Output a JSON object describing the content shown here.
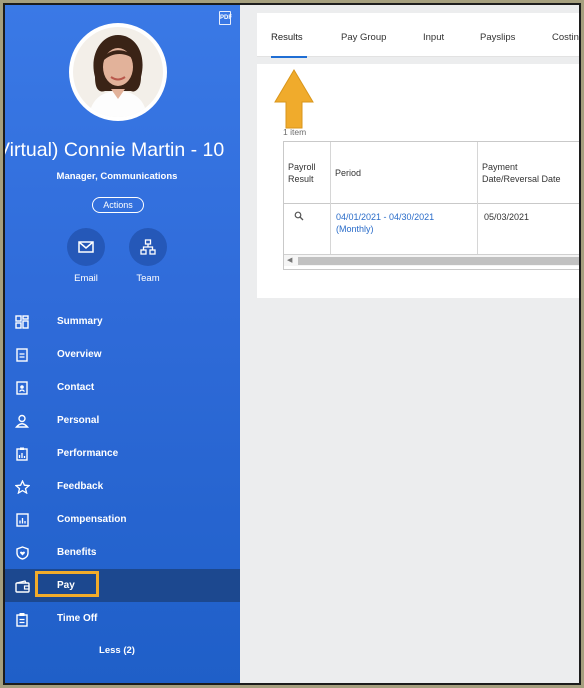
{
  "sidebar": {
    "pdf_label": "PDF",
    "worker_name": "Virtual) Connie Martin - 10",
    "worker_title": "Manager, Communications",
    "actions_label": "Actions",
    "email_label": "Email",
    "team_label": "Team",
    "nav": [
      {
        "label": "Summary",
        "icon": "summary-icon"
      },
      {
        "label": "Overview",
        "icon": "overview-icon"
      },
      {
        "label": "Contact",
        "icon": "contact-icon"
      },
      {
        "label": "Personal",
        "icon": "person-icon"
      },
      {
        "label": "Performance",
        "icon": "performance-icon"
      },
      {
        "label": "Feedback",
        "icon": "star-icon"
      },
      {
        "label": "Compensation",
        "icon": "compensation-icon"
      },
      {
        "label": "Benefits",
        "icon": "benefits-icon"
      },
      {
        "label": "Pay",
        "icon": "wallet-icon"
      },
      {
        "label": "Time Off",
        "icon": "time-off-icon"
      }
    ],
    "less_label": "Less (2)"
  },
  "tabs": [
    "Results",
    "Pay Group",
    "Input",
    "Payslips",
    "Costin"
  ],
  "results": {
    "item_count": "1 item",
    "headers": {
      "payroll_result": [
        "Payroll",
        "Result"
      ],
      "period": "Period",
      "payment_date": [
        "Payment",
        "Date/Reversal Date"
      ]
    },
    "rows": [
      {
        "period": [
          "04/01/2021 - 04/30/2021",
          "(Monthly)"
        ],
        "payment_date": "05/03/2021"
      }
    ]
  },
  "colors": {
    "sidebar_blue": "#2f6bd9",
    "active_nav": "#1c488f",
    "highlight": "#f2ac2a",
    "link": "#2a6cc9"
  }
}
